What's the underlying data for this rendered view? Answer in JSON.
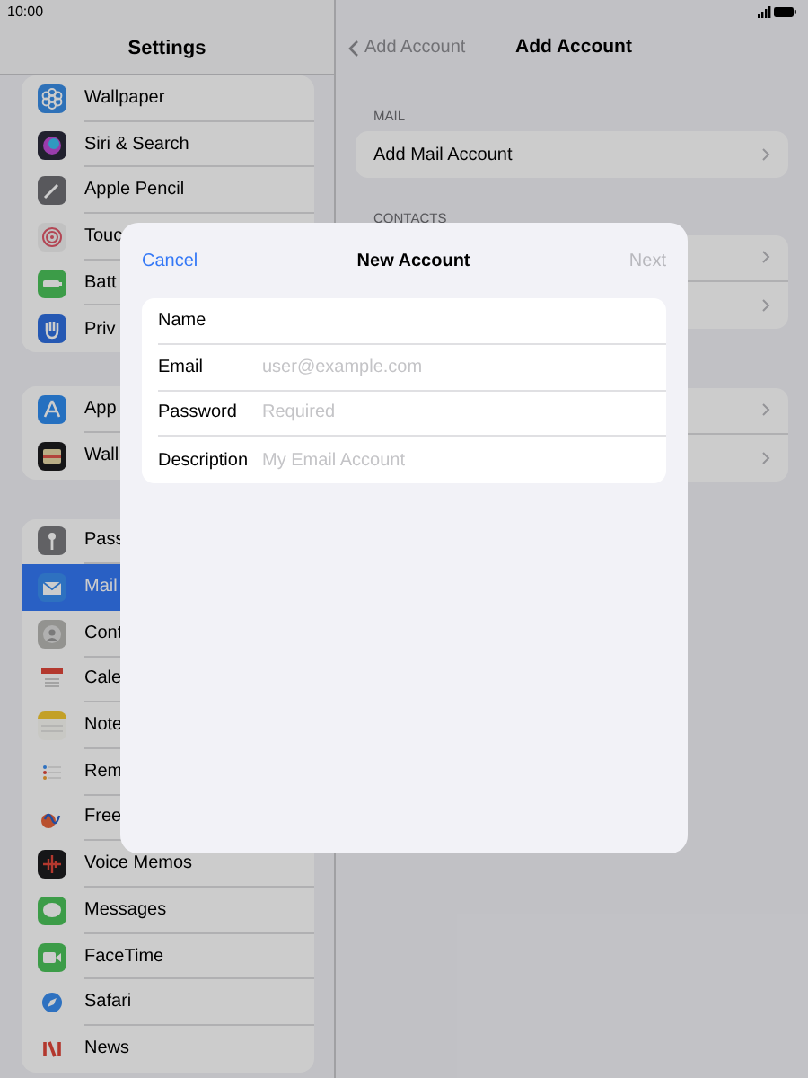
{
  "status_bar": {
    "time": "10:00"
  },
  "sidebar": {
    "title": "Settings",
    "groups": [
      [
        {
          "label": "Wallpaper",
          "selected": false
        },
        {
          "label": "Siri & Search",
          "selected": false
        },
        {
          "label": "Apple Pencil",
          "selected": false
        },
        {
          "label": "Touc",
          "selected": false
        },
        {
          "label": "Batt",
          "selected": false
        },
        {
          "label": "Priv",
          "selected": false
        }
      ],
      [
        {
          "label": "App",
          "selected": false
        },
        {
          "label": "Wall",
          "selected": false
        }
      ],
      [
        {
          "label": "Pass",
          "selected": false
        },
        {
          "label": "Mail",
          "selected": true
        },
        {
          "label": "Cont",
          "selected": false
        },
        {
          "label": "Cale",
          "selected": false
        },
        {
          "label": "Note",
          "selected": false
        },
        {
          "label": "Rem",
          "selected": false
        },
        {
          "label": "Free",
          "selected": false
        },
        {
          "label": "Voice Memos",
          "selected": false
        },
        {
          "label": "Messages",
          "selected": false
        },
        {
          "label": "FaceTime",
          "selected": false
        },
        {
          "label": "Safari",
          "selected": false
        },
        {
          "label": "News",
          "selected": false
        }
      ]
    ]
  },
  "detail": {
    "back": "Add Account",
    "title": "Add Account",
    "sections": [
      {
        "header": "MAIL",
        "rows": [
          {
            "label": "Add Mail Account"
          }
        ]
      },
      {
        "header": "CONTACTS",
        "rows": [
          {},
          {}
        ]
      },
      {
        "rows": [
          {},
          {}
        ]
      }
    ]
  },
  "dialog": {
    "cancel": "Cancel",
    "title": "New Account",
    "next": "Next",
    "next_disabled": true,
    "fields": [
      {
        "label": "Name"
      },
      {
        "label": "Email",
        "placeholder": "user@example.com"
      },
      {
        "label": "Password",
        "placeholder": "Required"
      },
      {
        "label": "Description",
        "placeholder": "My Email Account"
      }
    ]
  }
}
